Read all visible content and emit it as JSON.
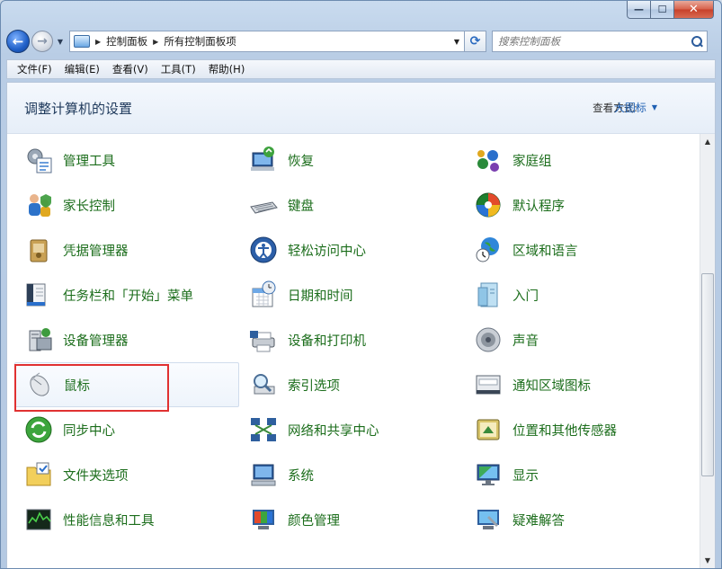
{
  "window": {
    "minimize_glyph": "—",
    "maximize_glyph": "☐",
    "close_glyph": "✕"
  },
  "nav": {
    "back_glyph": "←",
    "forward_glyph": "→",
    "address_crumbs": [
      "控制面板",
      "所有控制面板项"
    ],
    "search_placeholder": "搜索控制面板"
  },
  "menu": [
    "文件(F)",
    "编辑(E)",
    "查看(V)",
    "工具(T)",
    "帮助(H)"
  ],
  "header": {
    "title": "调整计算机的设置",
    "view_by_label": "查看方式:",
    "view_by_value": "大图标"
  },
  "colors": {
    "link_green": "#1b6d1b",
    "title_blue": "#1e395b",
    "highlight_red": "#e03131"
  },
  "items": [
    {
      "label": "管理工具",
      "icon": "admin-tools-icon"
    },
    {
      "label": "恢复",
      "icon": "recovery-icon"
    },
    {
      "label": "家庭组",
      "icon": "homegroup-icon"
    },
    {
      "label": "家长控制",
      "icon": "parental-controls-icon"
    },
    {
      "label": "键盘",
      "icon": "keyboard-icon"
    },
    {
      "label": "默认程序",
      "icon": "default-programs-icon"
    },
    {
      "label": "凭据管理器",
      "icon": "credential-manager-icon"
    },
    {
      "label": "轻松访问中心",
      "icon": "ease-of-access-icon"
    },
    {
      "label": "区域和语言",
      "icon": "region-language-icon"
    },
    {
      "label": "任务栏和「开始」菜单",
      "icon": "taskbar-icon"
    },
    {
      "label": "日期和时间",
      "icon": "date-time-icon"
    },
    {
      "label": "入门",
      "icon": "getting-started-icon"
    },
    {
      "label": "设备管理器",
      "icon": "device-manager-icon"
    },
    {
      "label": "设备和打印机",
      "icon": "devices-printers-icon"
    },
    {
      "label": "声音",
      "icon": "sound-icon"
    },
    {
      "label": "鼠标",
      "icon": "mouse-icon"
    },
    {
      "label": "索引选项",
      "icon": "indexing-options-icon"
    },
    {
      "label": "通知区域图标",
      "icon": "notification-area-icon"
    },
    {
      "label": "同步中心",
      "icon": "sync-center-icon"
    },
    {
      "label": "网络和共享中心",
      "icon": "network-sharing-icon"
    },
    {
      "label": "位置和其他传感器",
      "icon": "location-sensors-icon"
    },
    {
      "label": "文件夹选项",
      "icon": "folder-options-icon"
    },
    {
      "label": "系统",
      "icon": "system-icon"
    },
    {
      "label": "显示",
      "icon": "display-icon"
    },
    {
      "label": "性能信息和工具",
      "icon": "performance-icon"
    },
    {
      "label": "颜色管理",
      "icon": "color-management-icon"
    },
    {
      "label": "疑难解答",
      "icon": "troubleshooting-icon"
    }
  ]
}
